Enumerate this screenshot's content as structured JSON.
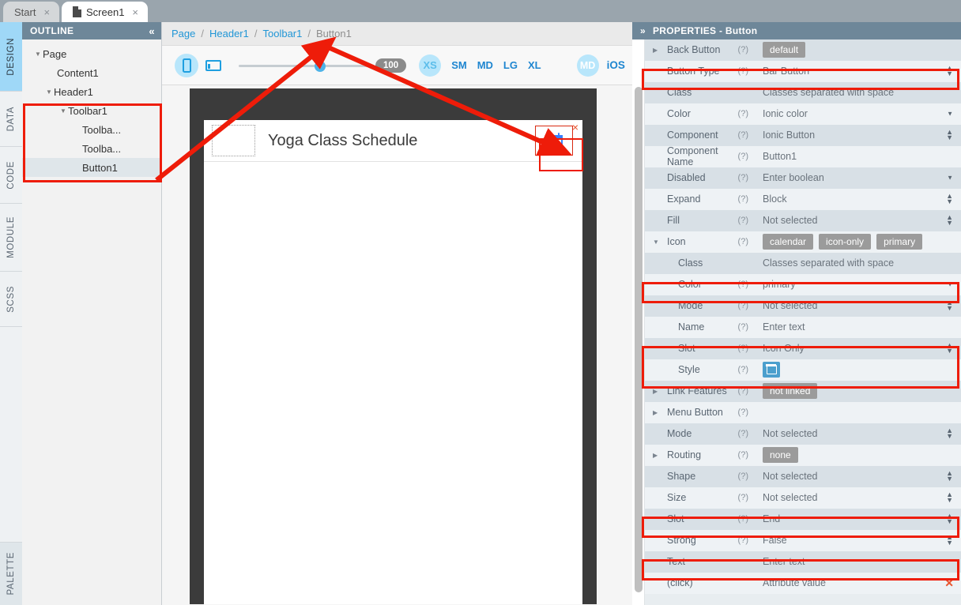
{
  "tabs": [
    {
      "label": "Start",
      "close": "×",
      "active": false
    },
    {
      "label": "Screen1",
      "close": "×",
      "active": true
    }
  ],
  "rail": {
    "items": [
      {
        "label": "DESIGN",
        "selected": true
      },
      {
        "label": "DATA",
        "selected": false
      },
      {
        "label": "CODE",
        "selected": false
      },
      {
        "label": "MODULE",
        "selected": false
      },
      {
        "label": "SCSS",
        "selected": false
      }
    ],
    "bottom": {
      "label": "PALETTE"
    }
  },
  "outline": {
    "title": "OUTLINE",
    "collapse_icon": "«",
    "nodes": [
      {
        "label": "Page",
        "indent": 0,
        "caret": "▼",
        "selected": false
      },
      {
        "label": "Content1",
        "indent": 1,
        "caret": "",
        "selected": false
      },
      {
        "label": "Header1",
        "indent": 1,
        "caret": "▼",
        "selected": false
      },
      {
        "label": "Toolbar1",
        "indent": 2,
        "caret": "▼",
        "selected": false
      },
      {
        "label": "Toolba...",
        "indent": 3,
        "caret": "",
        "selected": false
      },
      {
        "label": "Toolba...",
        "indent": 3,
        "caret": "",
        "selected": false
      },
      {
        "label": "Button1",
        "indent": 3,
        "caret": "",
        "selected": true
      }
    ]
  },
  "breadcrumb": {
    "items": [
      "Page",
      "Header1",
      "Toolbar1",
      "Button1"
    ],
    "separator": "/"
  },
  "viewtoolbar": {
    "phone_icon": "phone-icon",
    "tablet_icon": "tablet-icon",
    "zoom_value": "100",
    "breakpoints": [
      {
        "label": "XS",
        "selected": true
      },
      {
        "label": "SM",
        "selected": false
      },
      {
        "label": "MD",
        "selected": false
      },
      {
        "label": "LG",
        "selected": false
      },
      {
        "label": "XL",
        "selected": false
      }
    ],
    "mode_badge": "MD",
    "platform": "iOS"
  },
  "canvas": {
    "app_title": "Yoga Class Schedule",
    "selected_icon": "calendar-icon",
    "selection_close": "×"
  },
  "properties": {
    "title": "PROPERTIES - Button",
    "expand_icon": "»",
    "rows": [
      {
        "label": "Back Button",
        "help": "(?)",
        "indent": 0,
        "caret": "▶",
        "type": "tags",
        "tags": [
          "default"
        ]
      },
      {
        "label": "Button Type",
        "help": "(?)",
        "indent": 0,
        "caret": "",
        "type": "spin",
        "value": "Bar Button",
        "highlight": true
      },
      {
        "label": "Class",
        "help": "",
        "indent": 0,
        "caret": "",
        "type": "text",
        "value": "Classes separated with space"
      },
      {
        "label": "Color",
        "help": "(?)",
        "indent": 0,
        "caret": "",
        "type": "down",
        "value": "Ionic color"
      },
      {
        "label": "Component",
        "help": "(?)",
        "indent": 0,
        "caret": "",
        "type": "spin",
        "value": "Ionic Button"
      },
      {
        "label": "Component Name",
        "help": "(?)",
        "indent": 0,
        "caret": "",
        "type": "text",
        "value": "Button1"
      },
      {
        "label": "Disabled",
        "help": "(?)",
        "indent": 0,
        "caret": "",
        "type": "down",
        "value": "Enter boolean"
      },
      {
        "label": "Expand",
        "help": "(?)",
        "indent": 0,
        "caret": "",
        "type": "spin",
        "value": "Block"
      },
      {
        "label": "Fill",
        "help": "(?)",
        "indent": 0,
        "caret": "",
        "type": "spin",
        "value": "Not selected"
      },
      {
        "label": "Icon",
        "help": "(?)",
        "indent": 0,
        "caret": "▼",
        "type": "tags",
        "tags": [
          "calendar",
          "icon-only",
          "primary"
        ]
      },
      {
        "label": "Class",
        "help": "",
        "indent": 1,
        "caret": "",
        "type": "text",
        "value": "Classes separated with space"
      },
      {
        "label": "Color",
        "help": "(?)",
        "indent": 1,
        "caret": "",
        "type": "down",
        "value": "primary",
        "highlight": true
      },
      {
        "label": "Mode",
        "help": "(?)",
        "indent": 1,
        "caret": "",
        "type": "spin",
        "value": "Not selected"
      },
      {
        "label": "Name",
        "help": "(?)",
        "indent": 1,
        "caret": "",
        "type": "text",
        "value": "Enter text"
      },
      {
        "label": "Slot",
        "help": "(?)",
        "indent": 1,
        "caret": "",
        "type": "spin",
        "value": "Icon Only",
        "highlight": true
      },
      {
        "label": "Style",
        "help": "(?)",
        "indent": 1,
        "caret": "",
        "type": "swatch",
        "value": "",
        "highlight": true
      },
      {
        "label": "Link Features",
        "help": "(?)",
        "indent": 0,
        "caret": "▶",
        "type": "tags",
        "tags": [
          "not linked"
        ]
      },
      {
        "label": "Menu Button",
        "help": "(?)",
        "indent": 0,
        "caret": "▶",
        "type": "text",
        "value": ""
      },
      {
        "label": "Mode",
        "help": "(?)",
        "indent": 0,
        "caret": "",
        "type": "spin",
        "value": "Not selected"
      },
      {
        "label": "Routing",
        "help": "(?)",
        "indent": 0,
        "caret": "▶",
        "type": "tags",
        "tags": [
          "none"
        ]
      },
      {
        "label": "Shape",
        "help": "(?)",
        "indent": 0,
        "caret": "",
        "type": "spin",
        "value": "Not selected"
      },
      {
        "label": "Size",
        "help": "(?)",
        "indent": 0,
        "caret": "",
        "type": "spin",
        "value": "Not selected"
      },
      {
        "label": "Slot",
        "help": "(?)",
        "indent": 0,
        "caret": "",
        "type": "spin",
        "value": "End",
        "highlight": true
      },
      {
        "label": "Strong",
        "help": "(?)",
        "indent": 0,
        "caret": "",
        "type": "spin",
        "value": "False"
      },
      {
        "label": "Text",
        "help": "",
        "indent": 0,
        "caret": "",
        "type": "text",
        "value": "Enter text",
        "highlight": true
      },
      {
        "label": "(click)",
        "help": "",
        "indent": 0,
        "caret": "",
        "type": "x",
        "value": "Attribute value"
      }
    ]
  },
  "colors": {
    "accent_blue": "#2196d6",
    "panel_header": "#6e8799",
    "annotation_red": "#ee1c09",
    "ionic_primary": "#3880ff",
    "tag_gray": "#9b9b9b",
    "rail_selected": "#9fd8f7"
  }
}
